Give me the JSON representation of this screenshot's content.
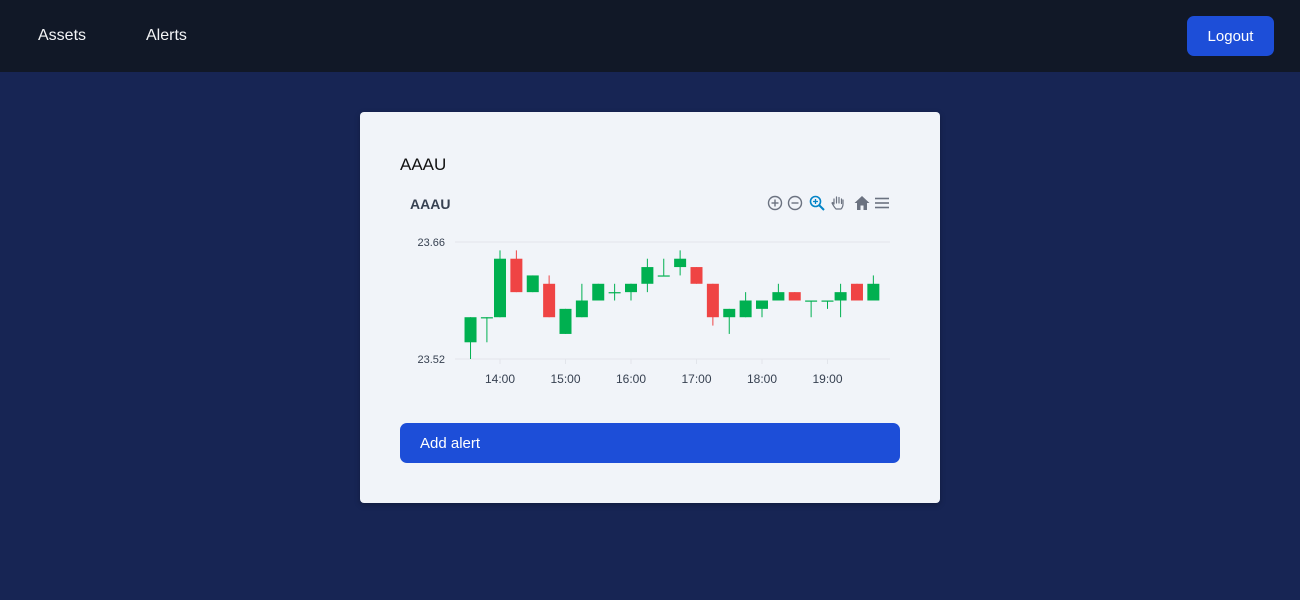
{
  "nav": {
    "assets_label": "Assets",
    "alerts_label": "Alerts",
    "logout_label": "Logout"
  },
  "card": {
    "title": "AAAU",
    "add_alert_label": "Add alert"
  },
  "chart_toolbar": [
    "zoom-in-icon",
    "zoom-out-icon",
    "selection-zoom-icon",
    "pan-icon",
    "reset-zoom-icon",
    "menu-icon"
  ],
  "colors": {
    "up": "#00b050",
    "down": "#ef4444",
    "accent": "#1d4ed8",
    "background": "#172554",
    "navbar": "#111827"
  },
  "chart_data": {
    "type": "candlestick",
    "title": "AAAU",
    "ylim": [
      23.52,
      23.66
    ],
    "y_ticks": [
      "23.66",
      "23.52"
    ],
    "x_ticks": [
      "14:00",
      "15:00",
      "16:00",
      "17:00",
      "18:00",
      "19:00"
    ],
    "x_tick_times": [
      14.0,
      15.0,
      16.0,
      17.0,
      18.0,
      19.0
    ],
    "candles": [
      {
        "t": 13.55,
        "o": 23.54,
        "h": 23.57,
        "l": 23.52,
        "c": 23.57
      },
      {
        "t": 13.8,
        "o": 23.57,
        "h": 23.57,
        "l": 23.54,
        "c": 23.57
      },
      {
        "t": 14.0,
        "o": 23.57,
        "h": 23.65,
        "l": 23.57,
        "c": 23.64
      },
      {
        "t": 14.25,
        "o": 23.64,
        "h": 23.65,
        "l": 23.6,
        "c": 23.6
      },
      {
        "t": 14.5,
        "o": 23.6,
        "h": 23.62,
        "l": 23.6,
        "c": 23.62
      },
      {
        "t": 14.75,
        "o": 23.61,
        "h": 23.62,
        "l": 23.57,
        "c": 23.57
      },
      {
        "t": 15.0,
        "o": 23.55,
        "h": 23.58,
        "l": 23.55,
        "c": 23.58
      },
      {
        "t": 15.25,
        "o": 23.57,
        "h": 23.61,
        "l": 23.57,
        "c": 23.59
      },
      {
        "t": 15.5,
        "o": 23.59,
        "h": 23.61,
        "l": 23.59,
        "c": 23.61
      },
      {
        "t": 15.75,
        "o": 23.6,
        "h": 23.61,
        "l": 23.59,
        "c": 23.6
      },
      {
        "t": 16.0,
        "o": 23.6,
        "h": 23.61,
        "l": 23.59,
        "c": 23.61
      },
      {
        "t": 16.25,
        "o": 23.61,
        "h": 23.64,
        "l": 23.6,
        "c": 23.63
      },
      {
        "t": 16.5,
        "o": 23.62,
        "h": 23.64,
        "l": 23.62,
        "c": 23.62
      },
      {
        "t": 16.75,
        "o": 23.63,
        "h": 23.65,
        "l": 23.62,
        "c": 23.64
      },
      {
        "t": 17.0,
        "o": 23.63,
        "h": 23.63,
        "l": 23.61,
        "c": 23.61
      },
      {
        "t": 17.25,
        "o": 23.61,
        "h": 23.61,
        "l": 23.56,
        "c": 23.57
      },
      {
        "t": 17.5,
        "o": 23.57,
        "h": 23.58,
        "l": 23.55,
        "c": 23.58
      },
      {
        "t": 17.75,
        "o": 23.57,
        "h": 23.6,
        "l": 23.57,
        "c": 23.59
      },
      {
        "t": 18.0,
        "o": 23.58,
        "h": 23.59,
        "l": 23.57,
        "c": 23.59
      },
      {
        "t": 18.25,
        "o": 23.59,
        "h": 23.61,
        "l": 23.59,
        "c": 23.6
      },
      {
        "t": 18.5,
        "o": 23.6,
        "h": 23.6,
        "l": 23.59,
        "c": 23.59
      },
      {
        "t": 18.75,
        "o": 23.59,
        "h": 23.59,
        "l": 23.57,
        "c": 23.59
      },
      {
        "t": 19.0,
        "o": 23.59,
        "h": 23.59,
        "l": 23.58,
        "c": 23.59
      },
      {
        "t": 19.2,
        "o": 23.59,
        "h": 23.61,
        "l": 23.57,
        "c": 23.6
      },
      {
        "t": 19.45,
        "o": 23.61,
        "h": 23.61,
        "l": 23.59,
        "c": 23.59
      },
      {
        "t": 19.7,
        "o": 23.59,
        "h": 23.62,
        "l": 23.59,
        "c": 23.61
      }
    ]
  }
}
